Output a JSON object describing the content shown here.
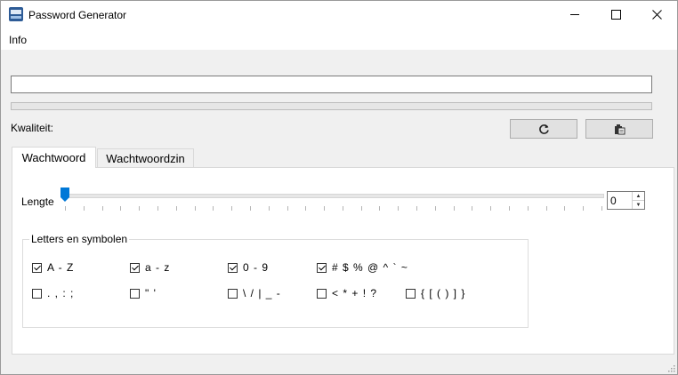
{
  "window": {
    "title": "Password Generator"
  },
  "menu": {
    "info": "Info"
  },
  "password": {
    "value": ""
  },
  "quality": {
    "label": "Kwaliteit:",
    "level": 0
  },
  "buttons": {
    "refresh_icon": "refresh-icon",
    "copy_icon": "clipboard-icon"
  },
  "tabs": [
    {
      "label": "Wachtwoord",
      "active": true
    },
    {
      "label": "Wachtwoordzin",
      "active": false
    }
  ],
  "length": {
    "label": "Lengte",
    "value": "0",
    "slider_position": 0,
    "tick_count": 30
  },
  "group": {
    "title": "Letters en symbolen",
    "options": [
      {
        "label": "A - Z",
        "checked": true
      },
      {
        "label": "a - z",
        "checked": true
      },
      {
        "label": "0 - 9",
        "checked": true
      },
      {
        "label": "# $ %  @ ^ ` ~",
        "checked": true
      },
      {
        "label": ". , : ;",
        "checked": false
      },
      {
        "label": "\" '",
        "checked": false
      },
      {
        "label": "\\ / | _ -",
        "checked": false
      },
      {
        "label": "< * + ! ?",
        "checked": false
      },
      {
        "label": "{ [ ( ) ] }",
        "checked": false
      }
    ]
  },
  "colors": {
    "accent": "#0078d7",
    "quality_fill": "#06b025"
  }
}
